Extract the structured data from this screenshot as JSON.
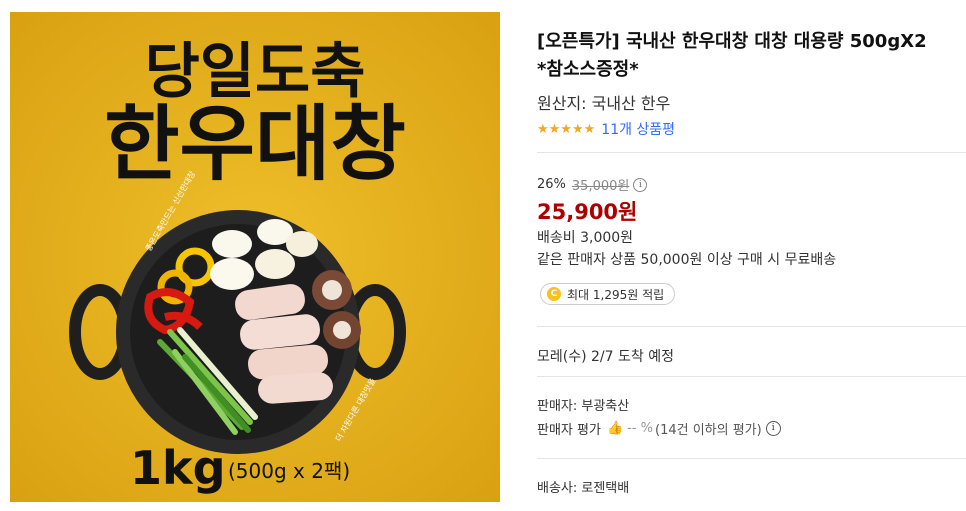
{
  "image": {
    "headline_top": "당일도축",
    "headline_main": "한우대창",
    "side_text_left": "좋은도축만드는 신선한대창",
    "side_text_right": "더 차원다른 대창맛을",
    "weight_big": "1kg",
    "weight_detail": "(500g x 2팩)",
    "colors": {
      "background": "#e8b51f",
      "pan": "#1f1f1f",
      "text": "#111111"
    }
  },
  "product": {
    "title": "[오픈특가] 국내산 한우대창 대창 대용량 500gX2 *참소스증정*",
    "origin": "원산지: 국내산 한우",
    "stars": "★★★★★",
    "review_count": "11개 상품평",
    "rating_value": 5
  },
  "price": {
    "discount": "26%",
    "original": "35,000원",
    "info_icon": "i",
    "sale": "25,900원",
    "shipping_fee": "배송비 3,000원",
    "free_shipping_note": "같은 판매자 상품 50,000원 이상 구매 시 무료배송",
    "cash_icon": "C",
    "cash_reward": "최대 1,295원 적립"
  },
  "delivery": {
    "arrival": "모레(수) 2/7 도착 예정"
  },
  "seller": {
    "name": "판매자: 부광축산",
    "rating_label": "판매자 평가",
    "rating_pct": "-- %",
    "rating_note": "(14건 이하의 평가)",
    "info_icon": "i"
  },
  "carrier": {
    "label": "배송사: 로젠택배"
  }
}
